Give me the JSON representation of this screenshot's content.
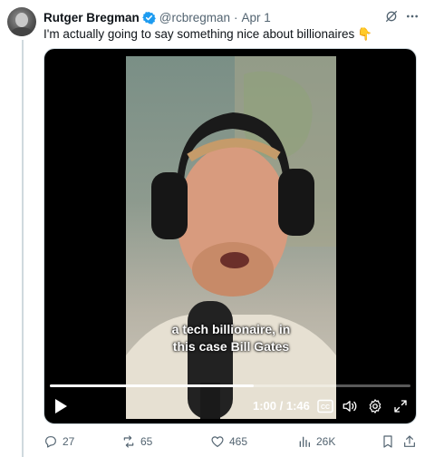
{
  "author": {
    "name": "Rutger Bregman",
    "handle": "@rcbregman",
    "separator": "·",
    "date": "Apr 1",
    "verified_color": "#1d9bf0"
  },
  "tweet": {
    "text": "I'm actually going to say something nice about billionaires",
    "emoji": "👇"
  },
  "video": {
    "caption_line1": "a tech billionaire, in",
    "caption_line2": "this case Bill Gates",
    "time": "1:00 / 1:46",
    "progress_fraction": 0.566,
    "cc_label": "CC"
  },
  "actions": {
    "replies": "27",
    "reposts": "65",
    "likes": "465",
    "views": "26K"
  },
  "colors": {
    "text": "#0f1419",
    "secondary": "#536471",
    "accent": "#1d9bf0"
  }
}
